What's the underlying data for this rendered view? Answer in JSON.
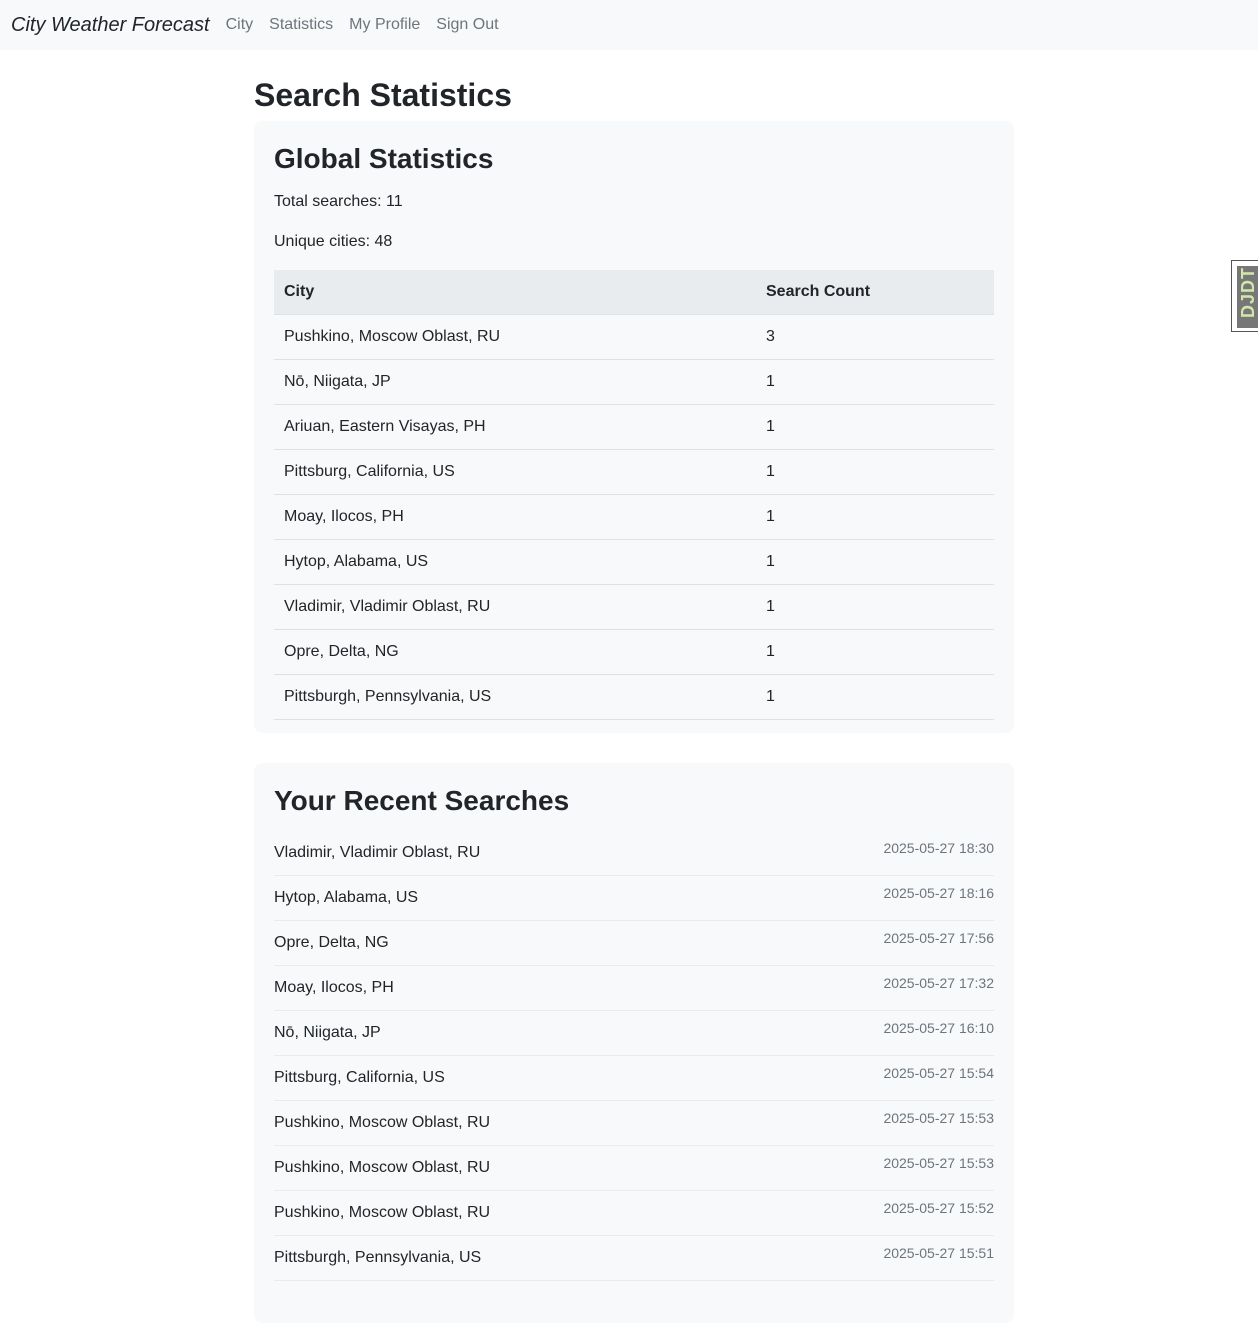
{
  "navbar": {
    "brand": "City Weather Forecast",
    "links": [
      "City",
      "Statistics",
      "My Profile",
      "Sign Out"
    ]
  },
  "page_title": "Search Statistics",
  "global_stats": {
    "heading": "Global Statistics",
    "total_searches": "Total searches: 11",
    "unique_cities": "Unique cities: 48",
    "table": {
      "headers": [
        "City",
        "Search Count"
      ],
      "rows": [
        [
          "Pushkino, Moscow Oblast, RU",
          "3"
        ],
        [
          "Nō, Niigata, JP",
          "1"
        ],
        [
          "Ariuan, Eastern Visayas, PH",
          "1"
        ],
        [
          "Pittsburg, California, US",
          "1"
        ],
        [
          "Moay, Ilocos, PH",
          "1"
        ],
        [
          "Hytop, Alabama, US",
          "1"
        ],
        [
          "Vladimir, Vladimir Oblast, RU",
          "1"
        ],
        [
          "Opre, Delta, NG",
          "1"
        ],
        [
          "Pittsburgh, Pennsylvania, US",
          "1"
        ]
      ]
    }
  },
  "recent_searches": {
    "heading": "Your Recent Searches",
    "items": [
      {
        "city": "Vladimir, Vladimir Oblast, RU",
        "time": "2025-05-27 18:30"
      },
      {
        "city": "Hytop, Alabama, US",
        "time": "2025-05-27 18:16"
      },
      {
        "city": "Opre, Delta, NG",
        "time": "2025-05-27 17:56"
      },
      {
        "city": "Moay, Ilocos, PH",
        "time": "2025-05-27 17:32"
      },
      {
        "city": "Nō, Niigata, JP",
        "time": "2025-05-27 16:10"
      },
      {
        "city": "Pittsburg, California, US",
        "time": "2025-05-27 15:54"
      },
      {
        "city": "Pushkino, Moscow Oblast, RU",
        "time": "2025-05-27 15:53"
      },
      {
        "city": "Pushkino, Moscow Oblast, RU",
        "time": "2025-05-27 15:53"
      },
      {
        "city": "Pushkino, Moscow Oblast, RU",
        "time": "2025-05-27 15:52"
      },
      {
        "city": "Pittsburgh, Pennsylvania, US",
        "time": "2025-05-27 15:51"
      }
    ]
  },
  "side_tab": {
    "label": "DJDT",
    "icon": "debug-toolbar-handle"
  },
  "colors": {
    "navbar_bg": "#f8f9fa",
    "card_bg": "#f8f9fa",
    "table_header_bg": "#e9ecef",
    "muted_text": "#6c757d"
  }
}
